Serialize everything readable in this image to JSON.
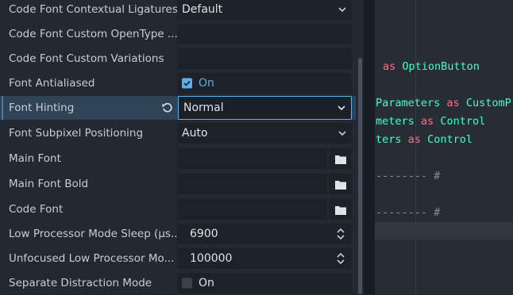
{
  "inspector": {
    "rows": [
      {
        "label": "Code Font Contextual Ligatures",
        "type": "dropdown",
        "value": "Default"
      },
      {
        "label": "Code Font Custom OpenType ...",
        "type": "text",
        "value": ""
      },
      {
        "label": "Code Font Custom Variations",
        "type": "text",
        "value": ""
      },
      {
        "label": "Font Antialiased",
        "type": "checkbox",
        "value": "On",
        "checked": true
      },
      {
        "label": "Font Hinting",
        "type": "dropdown",
        "value": "Normal",
        "selected": true
      },
      {
        "label": "Font Subpixel Positioning",
        "type": "dropdown",
        "value": "Auto"
      },
      {
        "label": "Main Font",
        "type": "file",
        "value": ""
      },
      {
        "label": "Main Font Bold",
        "type": "file",
        "value": ""
      },
      {
        "label": "Code Font",
        "type": "file",
        "value": ""
      },
      {
        "label": "Low Processor Mode Sleep (µs...",
        "type": "spin",
        "value": "6900"
      },
      {
        "label": "Unfocused Low Processor Mo...",
        "type": "spin",
        "value": "100000"
      },
      {
        "label": "Separate Distraction Mode",
        "type": "checkbox",
        "value": "On",
        "checked": false
      }
    ]
  },
  "code": {
    "line1": {
      "kw": "as",
      "type": "OptionButton"
    },
    "line2": {
      "pre": "Parameters",
      "kw": "as",
      "type": "CustomP"
    },
    "line3": {
      "pre": "meters",
      "kw": "as",
      "type": "Control"
    },
    "line4": {
      "pre": "ters",
      "kw": "as",
      "type": "Control"
    },
    "comment1": "-------- #",
    "comment2": "-------- #"
  },
  "colors": {
    "accent": "#5eaee8",
    "keyword": "#ff7085",
    "type": "#42ffc2",
    "comment": "#868b94",
    "selected_row": "#2f4356"
  }
}
